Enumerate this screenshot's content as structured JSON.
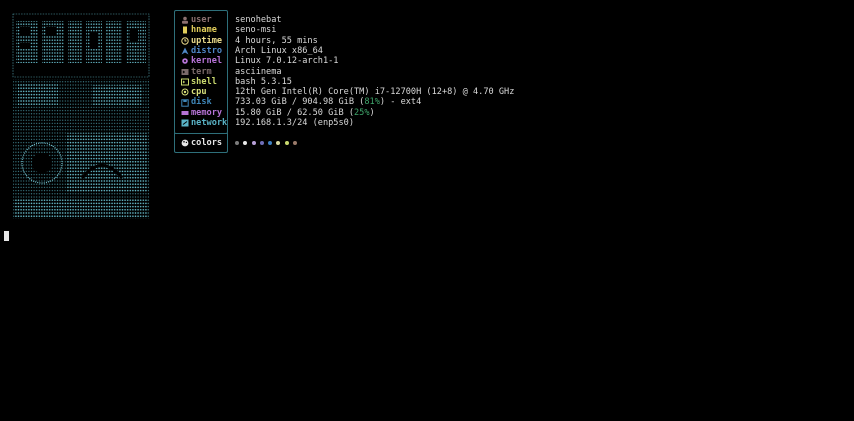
{
  "fields": [
    {
      "label": "user",
      "value": "senohebat",
      "color": "#8b6f6f",
      "icon": "user-icon"
    },
    {
      "label": "hname",
      "value": "seno-msi",
      "color": "#e0cc5a",
      "icon": "host-icon"
    },
    {
      "label": "uptime",
      "value": "4 hours, 55 mins",
      "color": "#e9d98a",
      "icon": "clock-icon"
    },
    {
      "label": "distro",
      "value": "Arch Linux x86_64",
      "color": "#4f86c6",
      "icon": "arch-icon"
    },
    {
      "label": "kernel",
      "value": "Linux 7.0.12-arch1-1",
      "color": "#b673d6",
      "icon": "gear-icon"
    },
    {
      "label": "term",
      "value": "asciinema",
      "color": "#7b6a6a",
      "icon": "terminal-icon"
    },
    {
      "label": "shell",
      "value": "bash 5.3.15",
      "color": "#c9d96e",
      "icon": "shell-icon"
    },
    {
      "label": "cpu",
      "value": "12th Gen Intel(R) Core(TM) i7-12700H (12+8) @ 4.70 GHz",
      "color": "#d8e07a",
      "icon": "cpu-icon"
    },
    {
      "label": "disk",
      "value": "733.03 GiB / 904.98 GiB (",
      "color": "#3f86b8",
      "icon": "disk-icon",
      "pct": "81%",
      "suffix": ") - ext4"
    },
    {
      "label": "memory",
      "value": "15.80 GiB / 62.50 GiB (",
      "color": "#b673d6",
      "icon": "memory-icon",
      "pct": "25%",
      "suffix": ")"
    },
    {
      "label": "network",
      "value": "192.168.1.3/24 (enp5s0)",
      "color": "#5ab3c6",
      "icon": "network-icon"
    }
  ],
  "colors_label": "colors",
  "palette": [
    "#7c7c7c",
    "#e8e8e8",
    "#b8a0d8",
    "#6f6fb8",
    "#3f7fc0",
    "#d8d8a0",
    "#c9d96e",
    "#9a7a6a"
  ],
  "palette_icon": "palette-icon"
}
